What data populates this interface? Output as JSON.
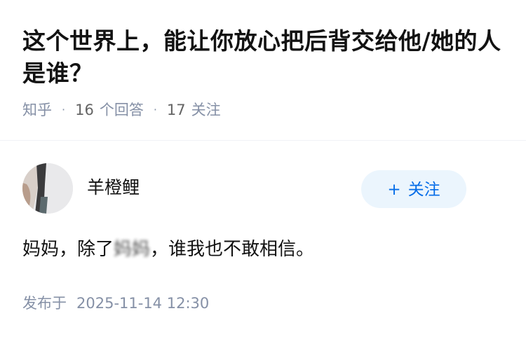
{
  "question": {
    "title": "这个世界上，能让你放心把后背交给他/她的人是谁？",
    "source": "知乎",
    "answers_count": "16",
    "answers_label": "个回答",
    "followers_count": "17",
    "followers_label": "关注"
  },
  "answer": {
    "author": {
      "name": "羊橙鲤"
    },
    "follow_button": {
      "plus": "+",
      "label": "关注"
    },
    "content": {
      "before": "妈妈，除了",
      "blurred": "妈妈",
      "after": "，谁我也不敢相信。"
    },
    "published": {
      "label": "发布于",
      "time": "2025-11-14 12:30"
    }
  },
  "colors": {
    "accent": "#056de8",
    "accent_bg": "#ebf5fd",
    "meta_text": "#8590a6",
    "title_text": "#121212"
  }
}
